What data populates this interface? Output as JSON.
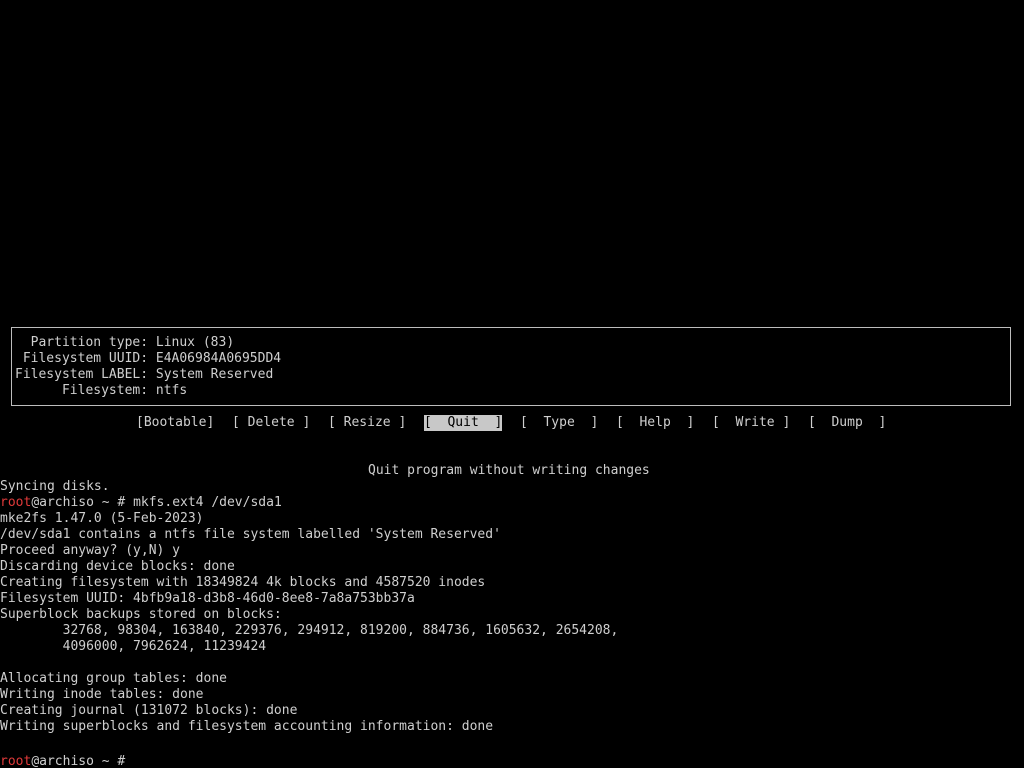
{
  "info": {
    "lines": [
      "  Partition type: Linux (83)",
      " Filesystem UUID: E4A06984A0695DD4",
      "Filesystem LABEL: System Reserved",
      "      Filesystem: ntfs"
    ]
  },
  "menu": {
    "items": [
      "[Bootable]",
      "[ Delete ]",
      "[ Resize ]",
      "[  Quit  ]",
      "[  Type  ]",
      "[  Help  ]",
      "[  Write ]",
      "[  Dump  ]"
    ],
    "selected_index": 3
  },
  "status": "Quit program without writing changes",
  "terminal": {
    "prompt_user": "root",
    "prompt_host": "@archiso ~ # ",
    "lines": [
      "Syncing disks.",
      "",
      "mke2fs 1.47.0 (5-Feb-2023)",
      "/dev/sda1 contains a ntfs file system labelled 'System Reserved'",
      "Proceed anyway? (y,N) y",
      "Discarding device blocks: done",
      "Creating filesystem with 18349824 4k blocks and 4587520 inodes",
      "Filesystem UUID: 4bfb9a18-d3b8-46d0-8ee8-7a8a753bb37a",
      "Superblock backups stored on blocks:",
      "        32768, 98304, 163840, 229376, 294912, 819200, 884736, 1605632, 2654208,",
      "        4096000, 7962624, 11239424",
      "",
      "Allocating group tables: done",
      "Writing inode tables: done",
      "Creating journal (131072 blocks): done",
      "Writing superblocks and filesystem accounting information: done",
      "",
      ""
    ],
    "command": "mkfs.ext4 /dev/sda1"
  }
}
